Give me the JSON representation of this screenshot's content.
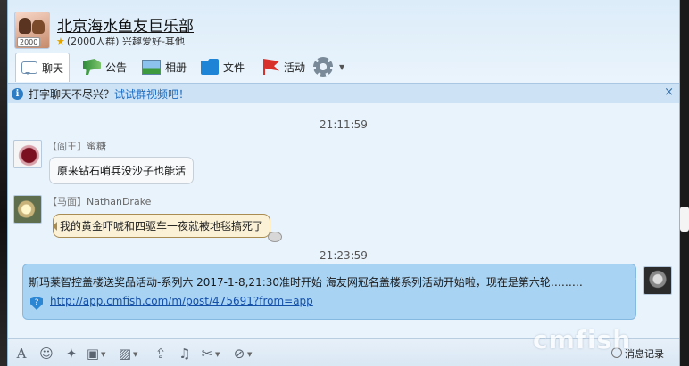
{
  "group": {
    "name": "北京海水鱼友巨乐部",
    "badge": "2000",
    "subtitle": "(2000人群) 兴趣爱好-其他"
  },
  "tabs": [
    {
      "label": "聊天",
      "icon": "chat-bubble-icon"
    },
    {
      "label": "公告",
      "icon": "megaphone-icon"
    },
    {
      "label": "相册",
      "icon": "photo-album-icon"
    },
    {
      "label": "文件",
      "icon": "folder-icon"
    },
    {
      "label": "活动",
      "icon": "flag-icon"
    },
    {
      "label": "",
      "icon": "gear-icon"
    }
  ],
  "tip": {
    "text": "打字聊天不尽兴？",
    "link": "试试群视频吧！",
    "close": "×"
  },
  "messages": {
    "time1": "21:11:59",
    "m1_title": "【阎王】",
    "m1_name": "蜜糖",
    "m1_text": "原来钻石哨兵没沙子也能活",
    "m2_title": "【马面】",
    "m2_name": "NathanDrake",
    "m2_text": "我的黄金吓唬和四驱车一夜就被地毯搞死了",
    "time2": "21:23:59",
    "m3_text": "斯玛莱智控盖楼送奖品活动-系列六 2017-1-8,21:30准时开始 海友网冠名盖楼系列活动开始啦，现在是第六轮………",
    "m3_link": "http://app.cmfish.com/m/post/475691?from=app"
  },
  "toolbar": {
    "items": [
      "font-icon",
      "emoji-icon",
      "magic-wand-icon",
      "gamepad-icon",
      "image-icon",
      "upload-icon",
      "music-icon",
      "scissors-icon",
      "screenshot-icon"
    ],
    "history_label": "消息记录",
    "watermark": "cmfish"
  },
  "colors": {
    "accent": "#1b6bbf",
    "tipbar": "#cde2f5",
    "chat_bg": "#e9f3fc",
    "own_bubble": "#a9d3f2"
  }
}
